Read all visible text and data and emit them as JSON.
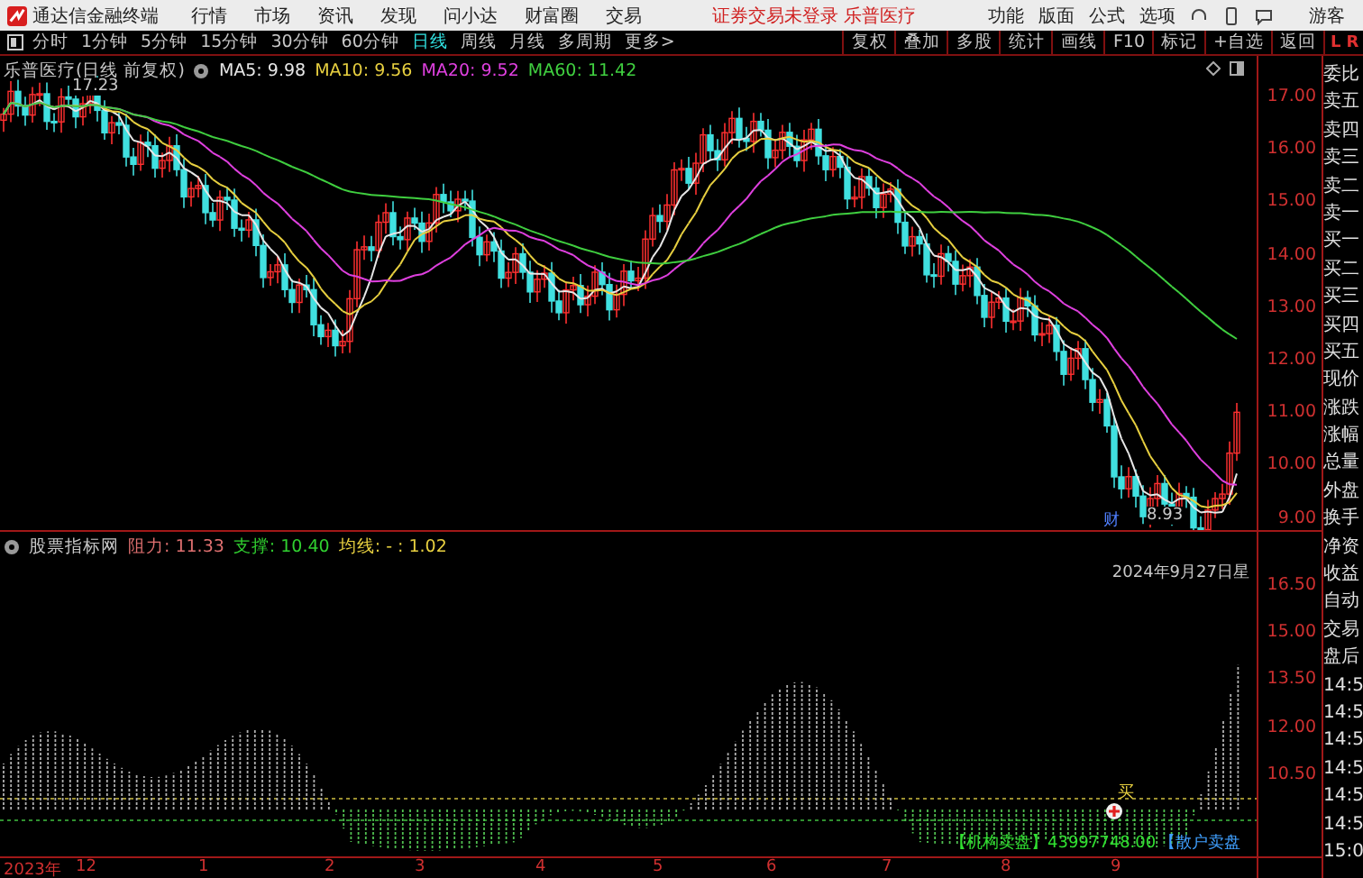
{
  "app": {
    "title": "通达信金融终端"
  },
  "menu": [
    "行情",
    "市场",
    "资讯",
    "发现",
    "问小达",
    "财富圈",
    "交易"
  ],
  "login_notice": "证券交易未登录",
  "stock_name": "乐普医疗",
  "right_menu": [
    "功能",
    "版面",
    "公式",
    "选项"
  ],
  "user": "游客",
  "periods": [
    {
      "label": "分时",
      "selected": false
    },
    {
      "label": "1分钟",
      "selected": false
    },
    {
      "label": "5分钟",
      "selected": false
    },
    {
      "label": "15分钟",
      "selected": false
    },
    {
      "label": "30分钟",
      "selected": false
    },
    {
      "label": "60分钟",
      "selected": false
    },
    {
      "label": "日线",
      "selected": true
    },
    {
      "label": "周线",
      "selected": false
    },
    {
      "label": "月线",
      "selected": false
    },
    {
      "label": "多周期",
      "selected": false
    },
    {
      "label": "更多>",
      "selected": false
    }
  ],
  "tools": [
    "复权",
    "叠加",
    "多股",
    "统计",
    "画线",
    "F10",
    "标记",
    "+自选",
    "返回"
  ],
  "corner": {
    "left": "L",
    "right": "R"
  },
  "main_chart": {
    "title": "乐普医疗(日线 前复权)",
    "ma": [
      {
        "label": "MA5: 9.98",
        "color": "#e8e8e8"
      },
      {
        "label": "MA10: 9.56",
        "color": "#e8d040"
      },
      {
        "label": "MA20: 9.52",
        "color": "#e040e0"
      },
      {
        "label": "MA60: 11.42",
        "color": "#40d040"
      }
    ],
    "high_label": "17.23",
    "low_label": "8.93",
    "event_label": "财",
    "price_ticks": [
      "17.00",
      "16.00",
      "15.00",
      "14.00",
      "13.00",
      "12.00",
      "11.00",
      "10.00",
      "9.00"
    ]
  },
  "indicator": {
    "name": "股票指标网",
    "values": [
      {
        "label": "阻力: 11.33",
        "color": "#e07070"
      },
      {
        "label": "支撑: 10.40",
        "color": "#30d030"
      },
      {
        "label": "均线: - : 1.02",
        "color": "#e8d040"
      }
    ],
    "date": "2024年9月27日星",
    "ticks": [
      "16.50",
      "15.00",
      "13.50",
      "12.00",
      "10.50"
    ],
    "buy_marker": "买",
    "flows": [
      {
        "label": "【机构卖盘】43997748.00",
        "color": "#30e030"
      },
      {
        "label": "【散户卖盘",
        "color": "#40a0ff"
      }
    ]
  },
  "side_panel": [
    "委比",
    "卖五",
    "卖四",
    "卖三",
    "卖二",
    "卖一",
    "买一",
    "买二",
    "买三",
    "买四",
    "买五",
    "现价",
    "涨跌",
    "涨幅",
    "总量",
    "外盘",
    "换手",
    "净资",
    "收益",
    "自动",
    "交易",
    "盘后",
    "14:5",
    "14:5",
    "14:5",
    "14:5",
    "14:5",
    "14:5",
    "15:0"
  ],
  "time_axis": [
    "2023年",
    "12",
    "1",
    "2",
    "3",
    "4",
    "5",
    "6",
    "7",
    "8",
    "9"
  ]
}
